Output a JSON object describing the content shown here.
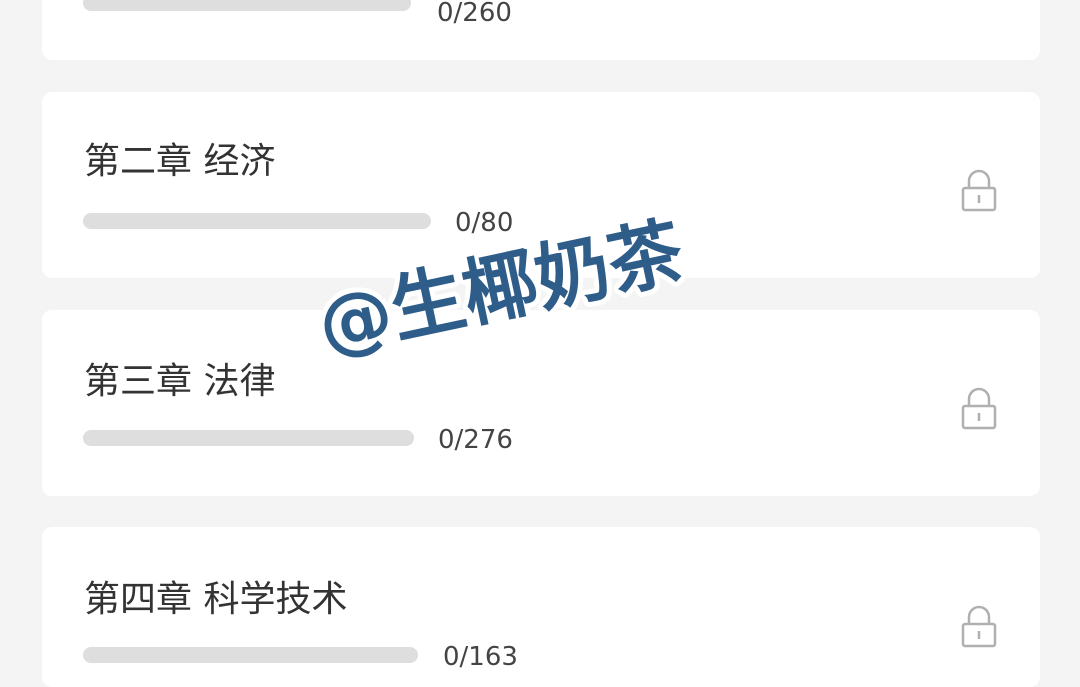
{
  "chapters": [
    {
      "title": "",
      "count": "0/260",
      "progress": 0,
      "locked": false
    },
    {
      "title": "第二章 经济",
      "count": "0/80",
      "progress": 0,
      "locked": true
    },
    {
      "title": "第三章 法律",
      "count": "0/276",
      "progress": 0,
      "locked": true
    },
    {
      "title": "第四章 科学技术",
      "count": "0/163",
      "progress": 0,
      "locked": true
    }
  ],
  "icons": {
    "lock": "lock-icon"
  },
  "watermark": {
    "text": "@生椰奶茶",
    "color": "#2f5d8a"
  },
  "colors": {
    "background": "#f4f4f4",
    "card": "#ffffff",
    "track": "#dedede",
    "text": "#333333",
    "lock": "#b0b0b0"
  }
}
